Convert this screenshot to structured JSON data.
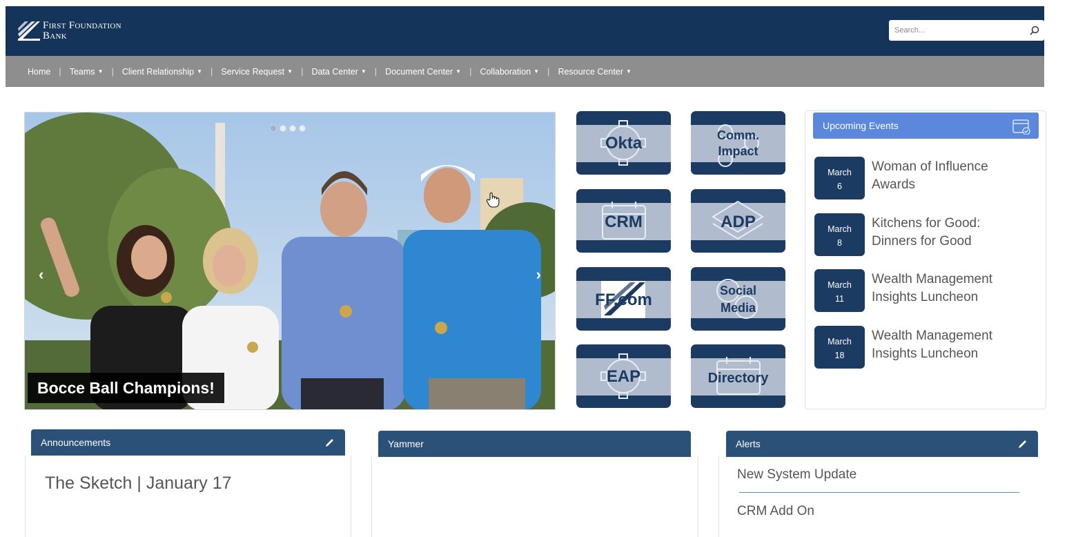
{
  "header": {
    "logo_line1": "First Foundation",
    "logo_line2": "Bank",
    "search_placeholder": "Search..."
  },
  "nav": {
    "items": [
      {
        "label": "Home",
        "dropdown": false
      },
      {
        "label": "Teams",
        "dropdown": true
      },
      {
        "label": "Client Relationship",
        "dropdown": true
      },
      {
        "label": "Service Request",
        "dropdown": true
      },
      {
        "label": "Data Center",
        "dropdown": true
      },
      {
        "label": "Document Center",
        "dropdown": true
      },
      {
        "label": "Collaboration",
        "dropdown": true
      },
      {
        "label": "Resource Center",
        "dropdown": true
      }
    ]
  },
  "carousel": {
    "caption": "Bocce Ball Champions!",
    "slide_count": 4,
    "active_slide": 1,
    "prev_icon": "chevron-left-icon",
    "next_icon": "chevron-right-icon"
  },
  "tiles": {
    "okta": "Okta",
    "comm_line1": "Comm.",
    "comm_line2": "Impact",
    "crm": "CRM",
    "adp": "ADP",
    "ffcom": "FF.com",
    "social_line1": "Social",
    "social_line2": "Media",
    "eap": "EAP",
    "directory": "Directory"
  },
  "events": {
    "title": "Upcoming Events",
    "items": [
      {
        "month": "March",
        "day": "6",
        "line1": "Woman of Influence",
        "line2": "Awards"
      },
      {
        "month": "March",
        "day": "8",
        "line1": "Kitchens for Good:",
        "line2": "Dinners for Good"
      },
      {
        "month": "March",
        "day": "11",
        "line1": "Wealth Management",
        "line2": "Insights Luncheon"
      },
      {
        "month": "March",
        "day": "18",
        "line1": "Wealth Management",
        "line2": "Insights Luncheon"
      }
    ]
  },
  "announcements": {
    "title": "Announcements",
    "item": "The Sketch | January 17"
  },
  "yammer": {
    "title": "Yammer"
  },
  "alerts": {
    "title": "Alerts",
    "items": [
      "New System Update",
      "CRM Add On"
    ]
  },
  "colors": {
    "header_bg": "#143459",
    "nav_bg": "#8e8e8e",
    "tile_navy": "#1b3b62",
    "tile_band": "#b0bccd",
    "events_accent": "#5b88da",
    "panel_header": "#2b5179"
  }
}
